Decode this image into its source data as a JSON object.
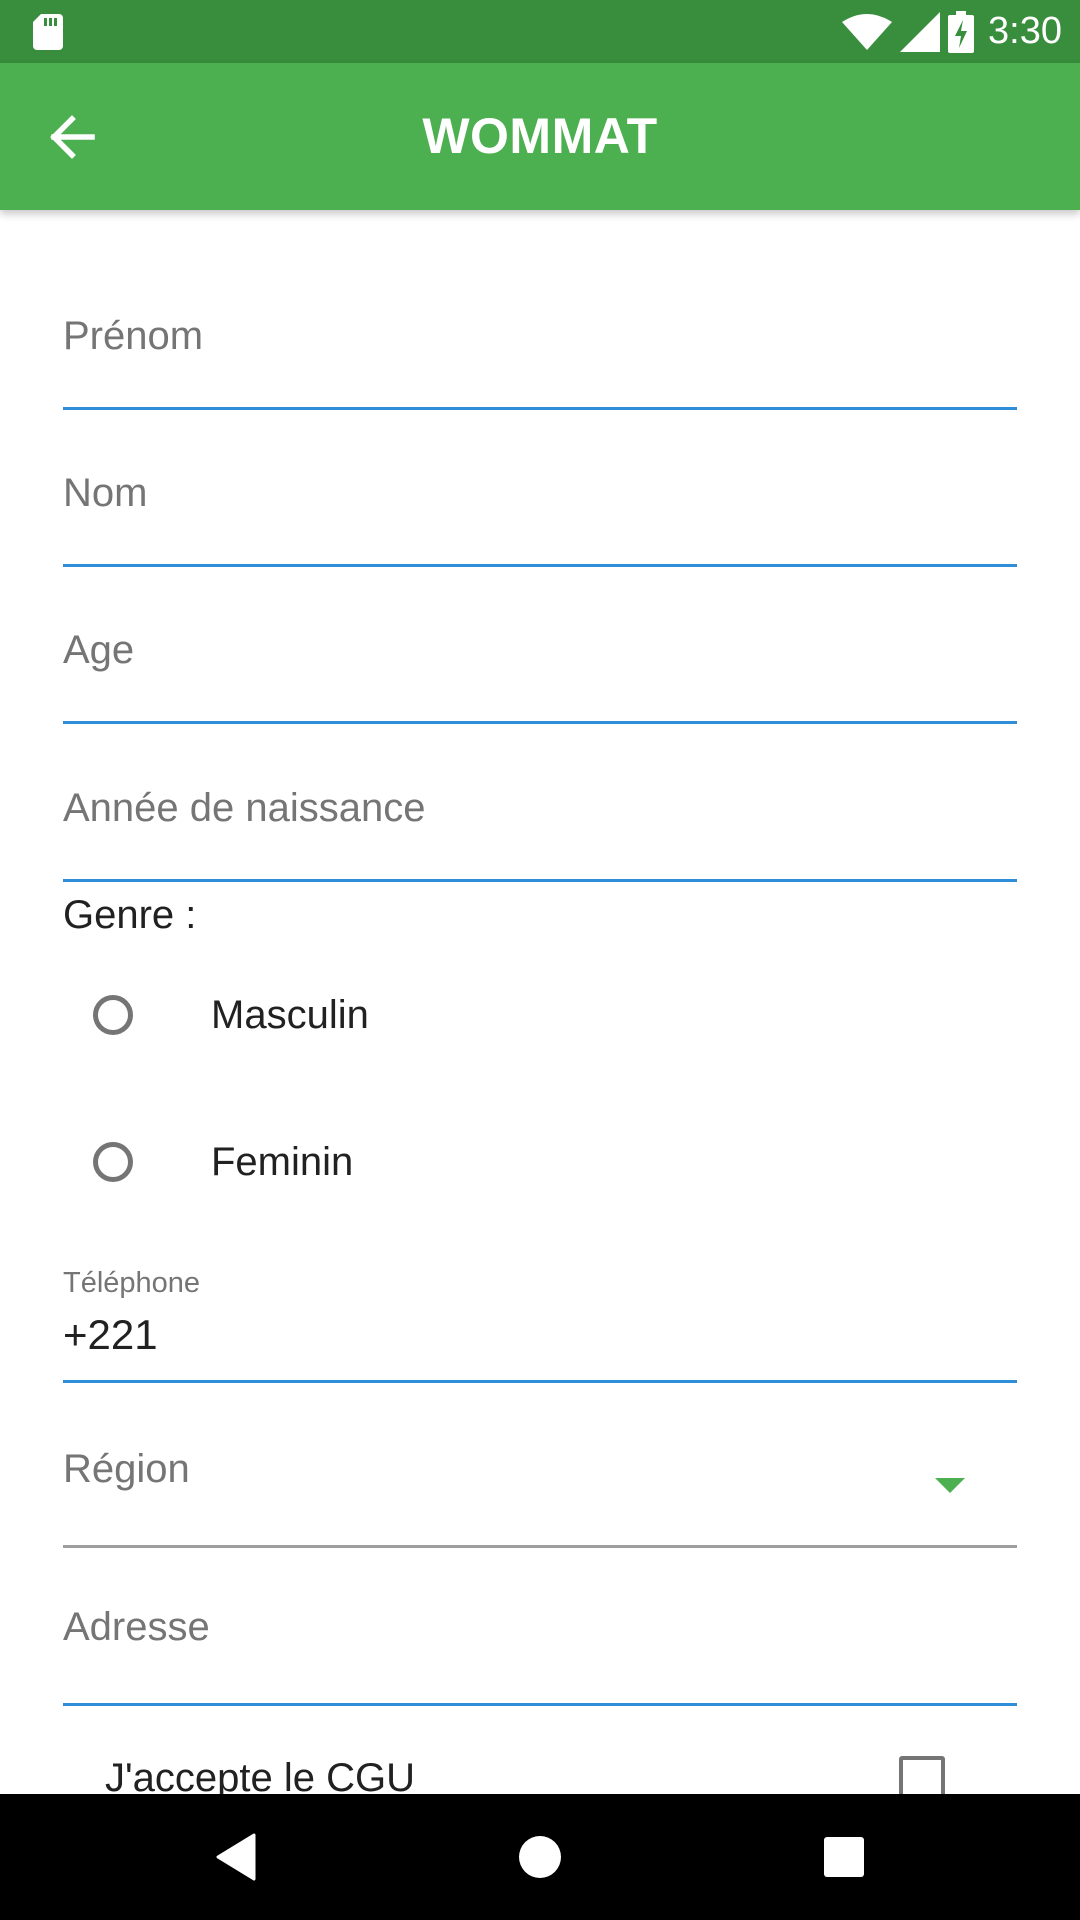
{
  "status_bar": {
    "time": "3:30",
    "icons": [
      "sd-card-icon",
      "wifi-icon",
      "signal-icon",
      "battery-charging-icon"
    ]
  },
  "app_bar": {
    "title": "WOMMAT",
    "back_icon": "arrow-left-icon"
  },
  "form": {
    "prenom": {
      "placeholder": "Prénom",
      "value": ""
    },
    "nom": {
      "placeholder": "Nom",
      "value": ""
    },
    "age": {
      "placeholder": "Age",
      "value": ""
    },
    "annee": {
      "placeholder": "Année de naissance",
      "value": ""
    },
    "genre": {
      "label": "Genre :",
      "options": [
        "Masculin",
        "Feminin"
      ],
      "selected": null
    },
    "telephone": {
      "label": "Téléphone",
      "value": "+221"
    },
    "region": {
      "placeholder": "Région",
      "value": ""
    },
    "adresse": {
      "placeholder": "Adresse",
      "value": ""
    },
    "cgu": {
      "label": "J'accepte le CGU",
      "checked": false
    }
  },
  "colors": {
    "status_bar": "#388e3c",
    "app_bar": "#4caf50",
    "focus_line": "#2f8ed7",
    "placeholder": "#757575"
  },
  "nav_bar": {
    "buttons": [
      "back-triangle-icon",
      "home-circle-icon",
      "recents-square-icon"
    ]
  }
}
